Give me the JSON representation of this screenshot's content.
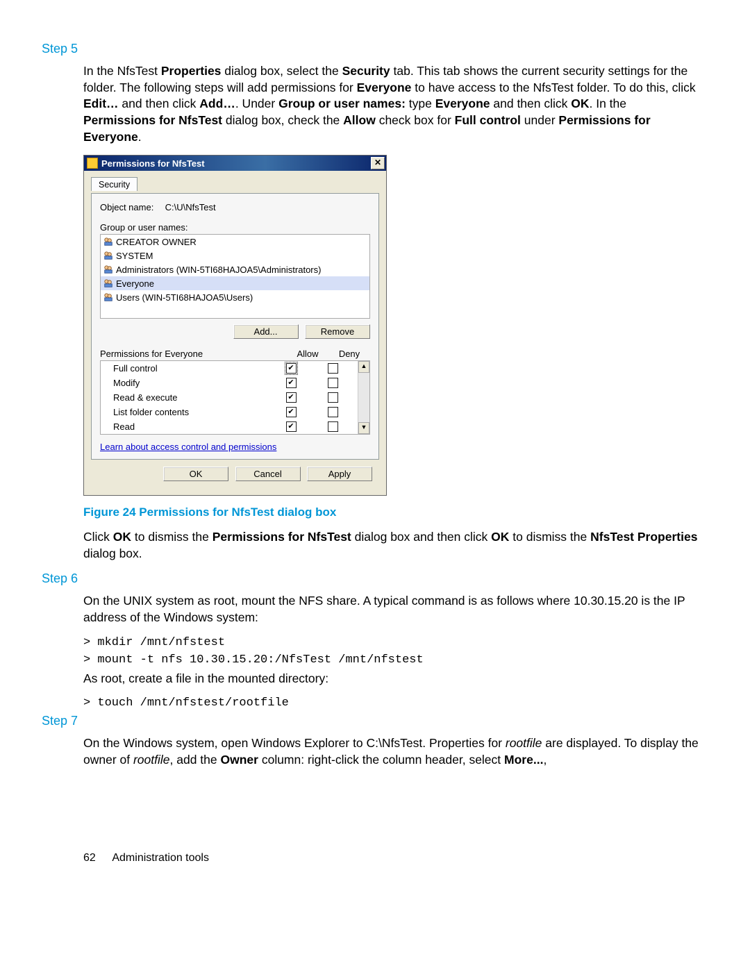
{
  "steps": {
    "s5": {
      "label": "Step 5"
    },
    "s6": {
      "label": "Step 6"
    },
    "s7": {
      "label": "Step 7"
    }
  },
  "para1": {
    "t1": "In the NfsTest ",
    "b1": "Properties",
    "t2": " dialog box, select the ",
    "b2": "Security",
    "t3": " tab. This tab shows the current security settings for the folder. The following steps will add permissions for ",
    "b3": "Everyone",
    "t4": " to have access to the NfsTest folder. To do this, click ",
    "b4": "Edit…",
    "t5": " and then click ",
    "b5": "Add…",
    "t6": ". Under ",
    "b6": "Group or user names:",
    "t7": " type ",
    "b7": "Everyone",
    "t8": " and then click ",
    "b8": "OK",
    "t9": ". In the ",
    "b9": "Permissions for NfsTest",
    "t10": " dialog box, check the ",
    "b10": "Allow",
    "t11": " check box for ",
    "b11": "Full control",
    "t12": " under ",
    "b12": "Permissions for Everyone",
    "t13": "."
  },
  "dialog": {
    "title": "Permissions for NfsTest",
    "tab": "Security",
    "object_name_label": "Object name:",
    "object_name_value": "C:\\U\\NfsTest",
    "group_label": "Group or user names:",
    "users": [
      "CREATOR OWNER",
      "SYSTEM",
      "Administrators (WIN-5TI68HAJOA5\\Administrators)",
      "Everyone",
      "Users (WIN-5TI68HAJOA5\\Users)"
    ],
    "add_btn": "Add...",
    "remove_btn": "Remove",
    "perm_title": "Permissions for Everyone",
    "allow_col": "Allow",
    "deny_col": "Deny",
    "perms": [
      {
        "name": "Full control",
        "allow": true,
        "deny": false
      },
      {
        "name": "Modify",
        "allow": true,
        "deny": false
      },
      {
        "name": "Read & execute",
        "allow": true,
        "deny": false
      },
      {
        "name": "List folder contents",
        "allow": true,
        "deny": false
      },
      {
        "name": "Read",
        "allow": true,
        "deny": false
      }
    ],
    "learn_link": "Learn about access control and permissions",
    "ok": "OK",
    "cancel": "Cancel",
    "apply": "Apply"
  },
  "figure_caption": "Figure 24 Permissions for NfsTest dialog box",
  "para2": {
    "t1": "Click ",
    "b1": "OK",
    "t2": " to dismiss the ",
    "b2": "Permissions for NfsTest",
    "t3": " dialog box and then click ",
    "b3": "OK",
    "t4": " to dismiss the ",
    "b4": "NfsTest Properties",
    "t5": " dialog box."
  },
  "para3": "On the UNIX system as root, mount the NFS share. A typical command is as follows where 10.30.15.20 is the IP address of the Windows system:",
  "cmd1": "> mkdir /mnt/nfstest",
  "cmd2": "> mount -t nfs 10.30.15.20:/NfsTest /mnt/nfstest",
  "para4": "As root, create a file in the mounted directory:",
  "cmd3": "> touch /mnt/nfstest/rootfile",
  "para5": {
    "t1": "On the Windows system, open Windows Explorer to C:\\NfsTest. Properties for ",
    "i1": "rootfile",
    "t2": " are displayed. To display the owner of ",
    "i2": "rootfile",
    "t3": ", add the ",
    "b1": "Owner",
    "t4": " column: right-click the column header, select ",
    "b2": "More...",
    "t5": ","
  },
  "footer": {
    "page": "62",
    "section": "Administration tools"
  }
}
